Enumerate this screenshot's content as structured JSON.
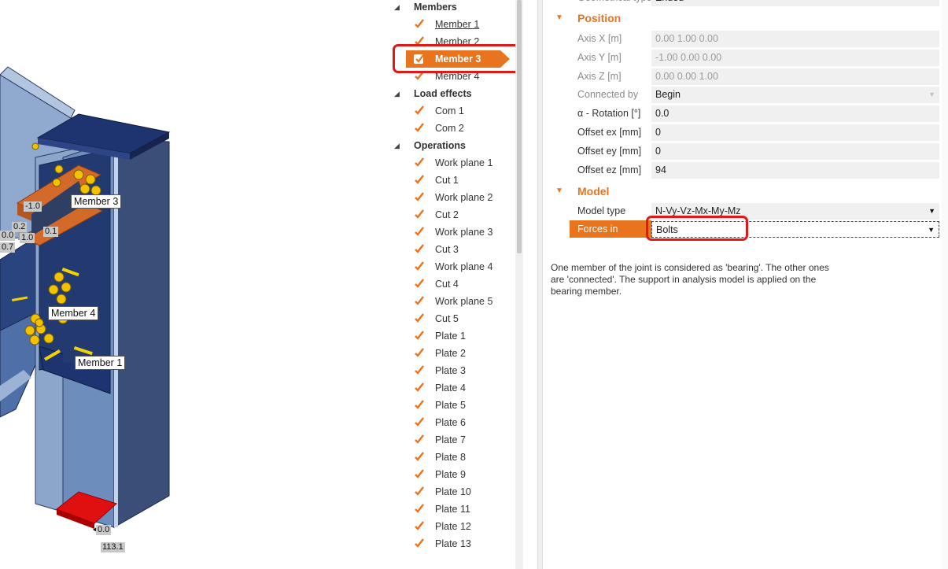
{
  "viewport": {
    "labels": {
      "member3": "Member 3",
      "member4": "Member 4",
      "member1": "Member 1"
    },
    "numbers": {
      "n_m10": "-1.0",
      "n_02": "0.2",
      "n_00a": "0.0",
      "n_10": "1.0",
      "n_01": "0.1",
      "n_07": "0.7",
      "n_00b": "0.0",
      "n_1131": "113.1"
    }
  },
  "tree": {
    "members_title": "Members",
    "members": [
      "Member 1",
      "Member 2",
      "Member 3",
      "Member 4"
    ],
    "selected_member": "Member 3",
    "load_effects_title": "Load effects",
    "load_effects": [
      "Com 1",
      "Com 2"
    ],
    "operations_title": "Operations",
    "operations": [
      "Work plane 1",
      "Cut 1",
      "Work plane 2",
      "Cut 2",
      "Work plane 3",
      "Cut 3",
      "Work plane 4",
      "Cut 4",
      "Work plane 5",
      "Cut 5",
      "Plate 1",
      "Plate 2",
      "Plate 3",
      "Plate 4",
      "Plate 5",
      "Plate 6",
      "Plate 7",
      "Plate 8",
      "Plate 9",
      "Plate 10",
      "Plate 11",
      "Plate 12",
      "Plate 13"
    ]
  },
  "properties": {
    "top_partial_label": "Geometrical type",
    "top_partial_value": "Ended",
    "position": {
      "title": "Position",
      "axis_x_label": "Axis X [m]",
      "axis_x_value": "0.00 1.00 0.00",
      "axis_y_label": "Axis Y [m]",
      "axis_y_value": "-1.00 0.00 0.00",
      "axis_z_label": "Axis Z [m]",
      "axis_z_value": "0.00 0.00 1.00",
      "connected_by_label": "Connected by",
      "connected_by_value": "Begin",
      "rotation_label": "α - Rotation [°]",
      "rotation_value": "0.0",
      "offset_ex_label": "Offset ex [mm]",
      "offset_ex_value": "0",
      "offset_ey_label": "Offset ey [mm]",
      "offset_ey_value": "0",
      "offset_ez_label": "Offset ez [mm]",
      "offset_ez_value": "94"
    },
    "model": {
      "title": "Model",
      "model_type_label": "Model type",
      "model_type_value": "N-Vy-Vz-Mx-My-Mz",
      "forces_in_label": "Forces in",
      "forces_in_value": "Bolts"
    },
    "info_text": "One member of the joint is considered as 'bearing'. The other ones are 'connected'. The support in analysis model is applied on the bearing member."
  },
  "colors": {
    "accent": "#e8741e",
    "highlight_box": "#e01818",
    "steel_blue": "#7b9ac4",
    "steel_navy": "#1e3260",
    "bolt_yellow": "#f2c200",
    "plate_red": "#e01010"
  }
}
